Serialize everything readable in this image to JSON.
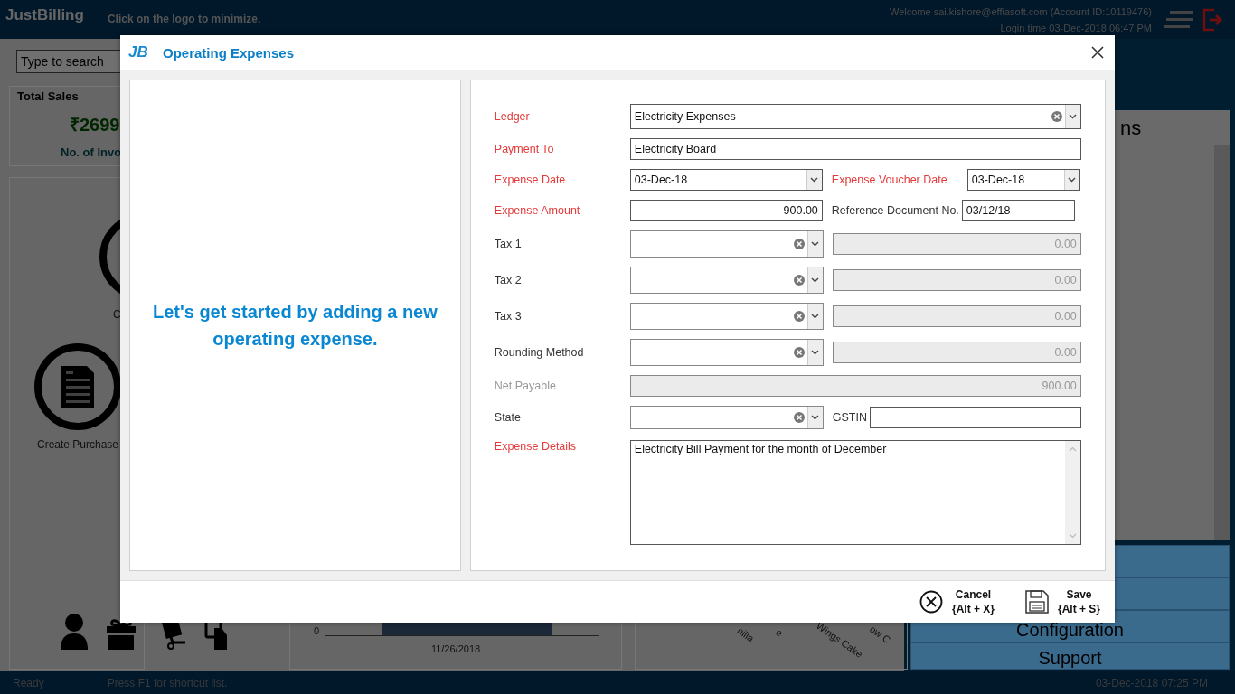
{
  "top_bar": {
    "logo": "JustBilling",
    "hint": "Click on the logo to minimize.",
    "welcome": "Welcome sai.kishore@effiasoft.com (Account ID:10119476)",
    "login_time": "Login time  03-Dec-2018 06:47 PM"
  },
  "search": {
    "placeholder": "Type to search"
  },
  "sales_card": {
    "title": "Total Sales",
    "amount": "₹2699",
    "subtitle": "No. of Invo"
  },
  "actions": [
    {
      "label": "C"
    },
    {
      "label": "Create Purchase"
    }
  ],
  "sales_chart": {
    "axis_label": "0",
    "date_label": "11/26/2018"
  },
  "item_chart": {
    "labels": [
      "nilla",
      "e",
      "Wings Cake",
      "ow C"
    ]
  },
  "side_panel": {
    "header": "ns",
    "menu": [
      {
        "label": "Configuration"
      },
      {
        "label": "Support"
      }
    ]
  },
  "status_bar": {
    "state": "Ready",
    "hint": "Press F1 for shortcut list.",
    "time": "03-Dec-2018 07:25 PM"
  },
  "dialog": {
    "logo": "JB",
    "title": "Operating Expenses",
    "intro": "Let's get started by adding a new operating expense.",
    "rows": [
      {
        "label": "Ledger",
        "required": true,
        "kind": "combo",
        "value": "Electricity Expenses"
      },
      {
        "label": "Payment To",
        "required": true,
        "kind": "text",
        "value": "Electricity Board"
      },
      {
        "label": "Expense Date",
        "required": true,
        "kind": "date",
        "value": "03-Dec-18",
        "side": {
          "label": "Expense Voucher Date",
          "required": true,
          "kind": "date",
          "value": "03-Dec-18"
        }
      },
      {
        "label": "Expense Amount",
        "required": true,
        "kind": "amount",
        "value": "900.00",
        "side": {
          "label": "Reference Document No.",
          "required": false,
          "kind": "text",
          "value": "03/12/18"
        }
      },
      {
        "label": "Tax 1",
        "required": false,
        "kind": "tax",
        "amount": "0.00"
      },
      {
        "label": "Tax 2",
        "required": false,
        "kind": "tax",
        "amount": "0.00"
      },
      {
        "label": "Tax 3",
        "required": false,
        "kind": "tax",
        "amount": "0.00"
      },
      {
        "label": "Rounding Method",
        "required": false,
        "kind": "tax",
        "amount": "0.00"
      },
      {
        "label": "Net Payable",
        "required": false,
        "kind": "total",
        "value": "900.00"
      },
      {
        "label": "State",
        "required": false,
        "kind": "state",
        "side": {
          "label": "GSTIN",
          "required": false,
          "kind": "text"
        }
      },
      {
        "label": "Expense Details",
        "required": true,
        "kind": "memo",
        "value": "Electricity Bill Payment for the month of December"
      }
    ],
    "buttons": [
      {
        "kind": "cancel",
        "label": "Cancel",
        "shortcut": "{Alt + X}"
      },
      {
        "kind": "save",
        "label": "Save",
        "shortcut": "{Alt + S}"
      }
    ]
  }
}
